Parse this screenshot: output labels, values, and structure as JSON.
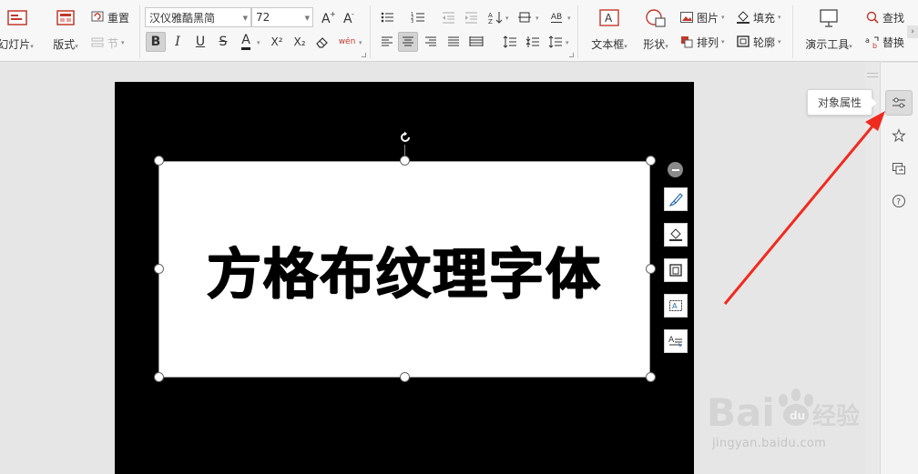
{
  "ribbon": {
    "slide_group": {
      "new_slide": "幻灯片",
      "layout": "版式",
      "reset": "重置",
      "section": "节"
    },
    "font": {
      "family": "汉仪雅酷黑简",
      "size": "72",
      "grow_icon": "A⁺",
      "shrink_icon": "A⁻",
      "bold": "B",
      "italic": "I",
      "underline": "U",
      "strikethrough": "S",
      "font_color": "A",
      "superscript": "X²",
      "subscript": "X₂",
      "phonetic": "wén"
    },
    "paragraph": {
      "text_direction_label": "AB"
    },
    "insert": {
      "textbox": "文本框",
      "shape": "形状",
      "picture": "图片",
      "arrange": "排列",
      "fill": "填充",
      "outline": "轮廓",
      "presentation_tools": "演示工具",
      "find": "查找",
      "replace": "替换"
    }
  },
  "slide": {
    "text": "方格布纹理字体"
  },
  "right_pane": {
    "tooltip": "对象属性"
  },
  "watermark": {
    "logo": "Bai 经验",
    "url": "jingyan.baidu.com"
  },
  "colors": {
    "arrow": "#f02a1e",
    "slide_bg": "#000000",
    "textbox_bg": "#ffffff"
  }
}
